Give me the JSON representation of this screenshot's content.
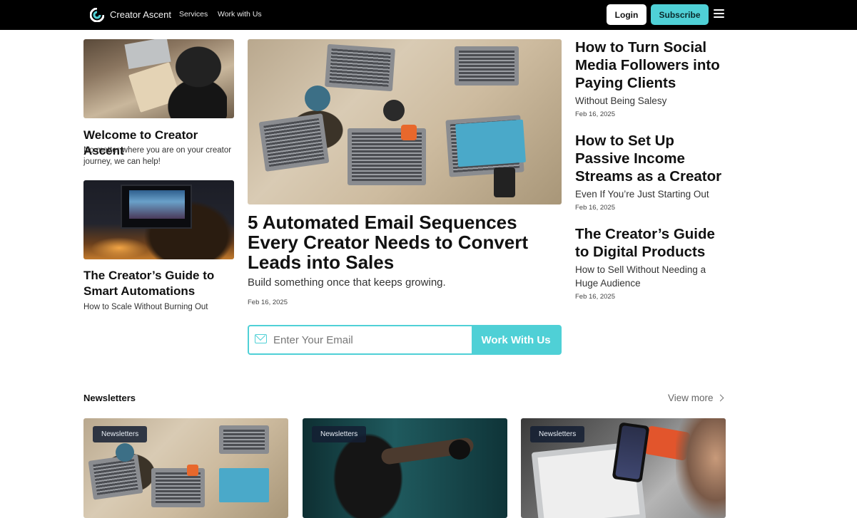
{
  "nav": {
    "brand": "Creator Ascent",
    "links": [
      "Services",
      "Work with Us"
    ],
    "login": "Login",
    "subscribe": "Subscribe",
    "logo_icon": "creator-ascent-logo",
    "menu_icon": "hamburger-menu-icon"
  },
  "left": {
    "welcome": {
      "title": "Welcome to Creator Ascent",
      "subtitle": "No matter where you are on your creator journey, we can help!"
    },
    "automations": {
      "title": "The Creator’s Guide to Smart Automations",
      "subtitle": "How to Scale Without Burning Out"
    }
  },
  "hero": {
    "title": "5 Automated Email Sequences Every Creator Needs to Convert Leads into Sales",
    "subtitle": "Build something once that keeps growing.",
    "date": "Feb 16, 2025",
    "email_placeholder": "Enter Your Email",
    "email_value": "",
    "cta": "Work With Us"
  },
  "side": [
    {
      "title": "How to Turn Social Media Followers into Paying Clients",
      "subtitle": "Without Being Salesy",
      "date": "Feb 16, 2025"
    },
    {
      "title": "How to Set Up Passive Income Streams as a Creator",
      "subtitle": "Even If You’re Just Starting Out",
      "date": "Feb 16, 2025"
    },
    {
      "title": "The Creator’s Guide to Digital Products",
      "subtitle": "How to Sell Without Needing a Huge Audience",
      "date": "Feb 16, 2025"
    }
  ],
  "newsletters": {
    "title": "Newsletters",
    "view_more": "View more",
    "cards": [
      {
        "tag": "Newsletters"
      },
      {
        "tag": "Newsletters"
      },
      {
        "tag": "Newsletters"
      }
    ]
  },
  "colors": {
    "accent": "#4fd0d6",
    "nav_bg": "#000000"
  }
}
